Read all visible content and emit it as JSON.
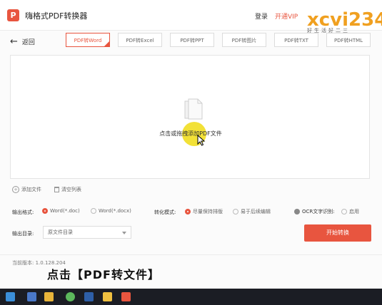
{
  "app": {
    "title": "嗨格式PDF转换器",
    "login": "登录",
    "vip": "开通VIP",
    "back_label": "返回",
    "logo_letter": "P"
  },
  "watermark": {
    "logo_text": "xcvi234",
    "tagline": "好生活好二三"
  },
  "tabs": [
    {
      "label": "PDF转Word",
      "active": true
    },
    {
      "label": "PDF转Excel",
      "active": false
    },
    {
      "label": "PDF转PPT",
      "active": false
    },
    {
      "label": "PDF转图片",
      "active": false
    },
    {
      "label": "PDF转TXT",
      "active": false
    },
    {
      "label": "PDF转HTML",
      "active": false
    }
  ],
  "dropzone": {
    "text": "点击或拖拽添加PDF文件"
  },
  "file_actions": {
    "add": "添加文件",
    "clear": "清空列表"
  },
  "options": {
    "format_label": "输出格式:",
    "format_opts": [
      "Word(*.doc)",
      "Word(*.docx)"
    ],
    "mode_label": "转化模式:",
    "mode_opts": [
      "尽量保持排版",
      "易于后续编辑"
    ],
    "ocr_label": "OCR文字识别:",
    "ocr_enable": "启用"
  },
  "output": {
    "dir_label": "输出目录:",
    "dir_value": "原文件目录",
    "start_button": "开始转换"
  },
  "version": "当前版本: 1.0.128.204",
  "caption": "点击【PDF转文件】",
  "colors": {
    "accent": "#e8553f",
    "taskbar": "#1b1d24",
    "highlight": "#f0dc14"
  }
}
